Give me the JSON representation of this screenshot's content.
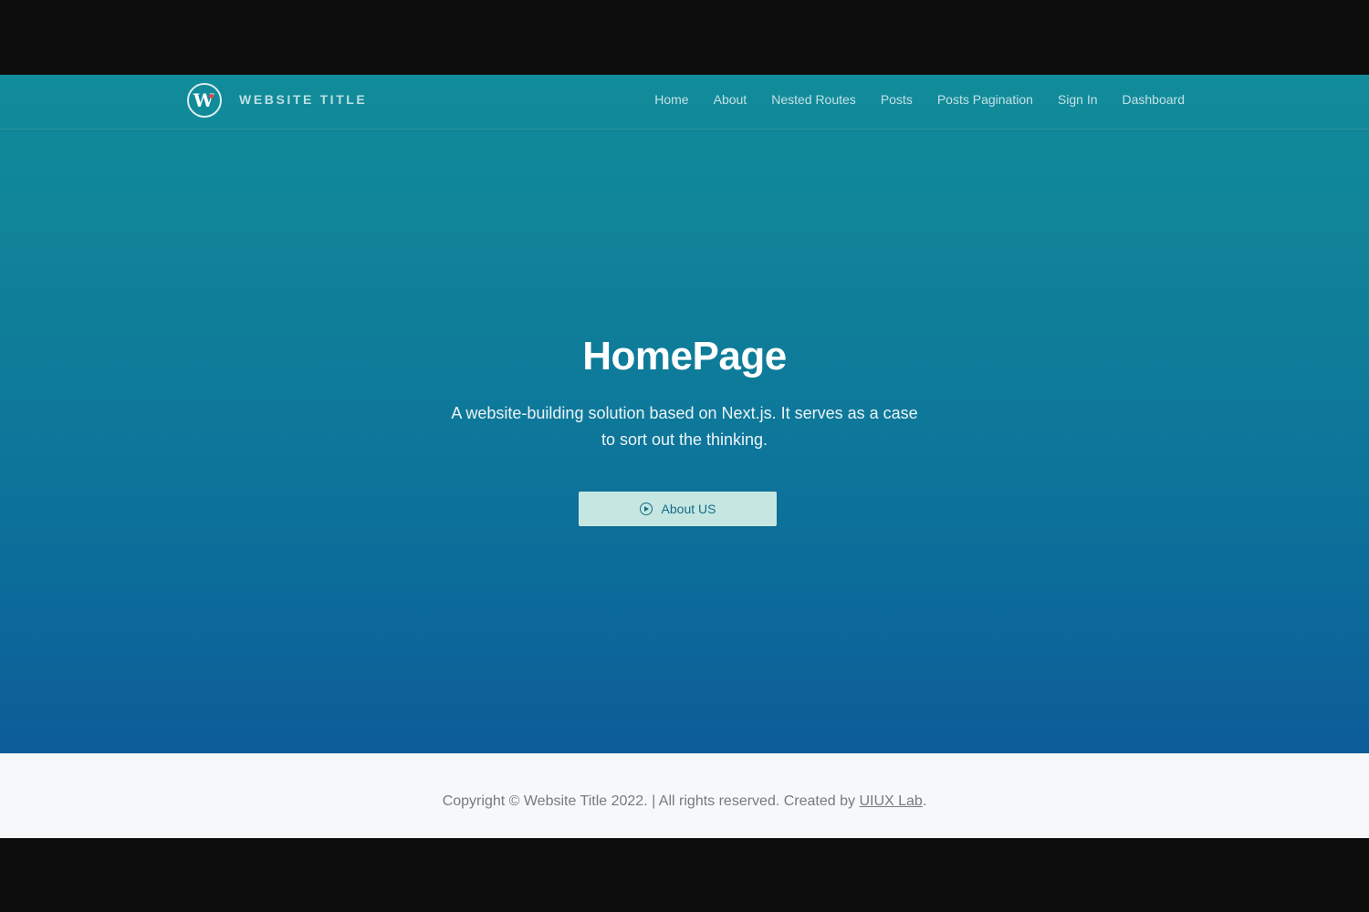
{
  "header": {
    "logo_icon": "w-logo-icon",
    "site_title": "WEBSITE TITLE",
    "nav": [
      {
        "label": "Home"
      },
      {
        "label": "About"
      },
      {
        "label": "Nested Routes"
      },
      {
        "label": "Posts"
      },
      {
        "label": "Posts Pagination"
      },
      {
        "label": "Sign In"
      },
      {
        "label": "Dashboard"
      }
    ]
  },
  "hero": {
    "title": "HomePage",
    "description": "A website-building solution based on Next.js. It serves as a case to sort out the thinking.",
    "cta_icon": "play-circle-icon",
    "cta_label": "About US"
  },
  "footer": {
    "prefix": "Copyright © Website Title 2022. | All rights reserved. Created by ",
    "link_label": "UIUX Lab",
    "suffix": "."
  },
  "colors": {
    "gradient_top": "#118c9a",
    "gradient_bottom": "#0c5c98",
    "cta_background": "#c6e7e1",
    "cta_text": "#136c8a",
    "footer_background": "#f7f8f9",
    "logo_dot": "#e8434f"
  }
}
